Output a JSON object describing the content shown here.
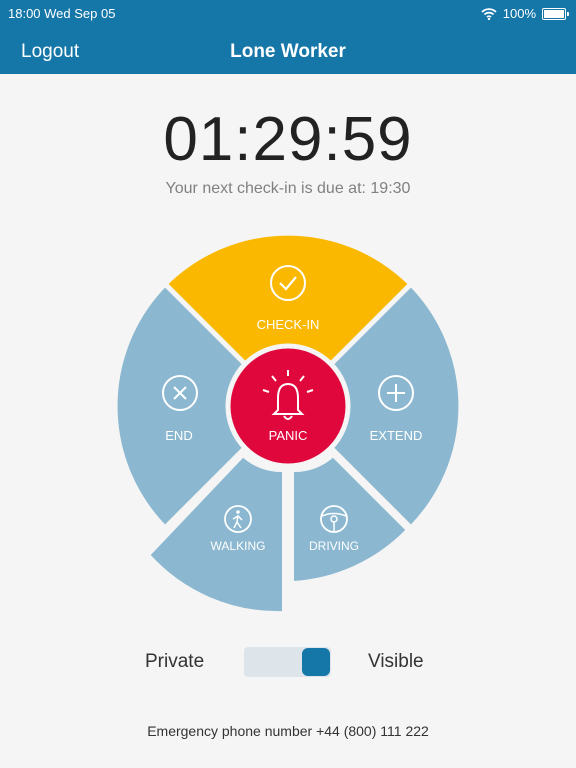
{
  "status": {
    "time": "18:00 Wed Sep 05",
    "battery": "100%"
  },
  "header": {
    "logout_label": "Logout",
    "title": "Lone Worker"
  },
  "timer": {
    "countdown": "01:29:59",
    "next_checkin": "Your next check-in is due at: 19:30"
  },
  "dial": {
    "check_in": "CHECK-IN",
    "end": "END",
    "extend": "EXTEND",
    "panic": "PANIC",
    "walking": "WALKING",
    "driving": "DRIVING"
  },
  "privacy": {
    "private_label": "Private",
    "visible_label": "Visible",
    "is_visible": true
  },
  "footer": {
    "emergency": "Emergency phone number +44 (800) 111 222"
  },
  "colors": {
    "header": "#1576a8",
    "check_in": "#fbb800",
    "segment": "#8bb8d0",
    "panic": "#e0073d",
    "background": "#f5f5f5"
  },
  "icons": [
    "wifi-icon",
    "battery-icon",
    "checkmark-icon",
    "close-icon",
    "plus-icon",
    "bell-icon",
    "walking-icon",
    "steering-wheel-icon"
  ]
}
